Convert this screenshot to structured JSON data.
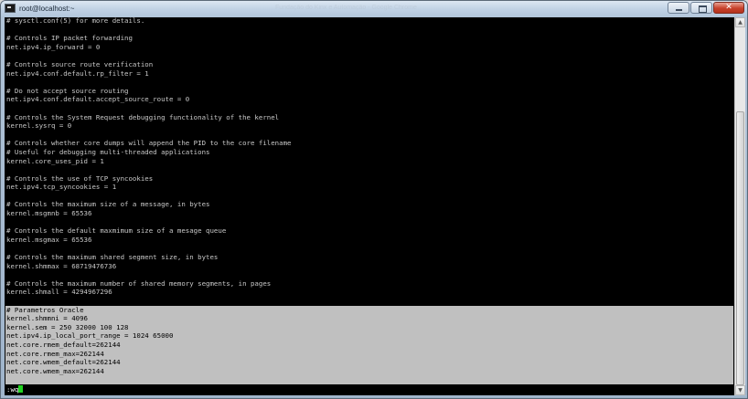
{
  "window": {
    "title": "root@localhost:~",
    "background_caption": "Fundação do Kinx e Automação - Google Chrome",
    "controls": {
      "minimize": "minimize",
      "maximize": "maximize",
      "close": "close"
    }
  },
  "terminal": {
    "lines": [
      "# sysctl.conf(5) for more details.",
      "",
      "# Controls IP packet forwarding",
      "net.ipv4.ip_forward = 0",
      "",
      "# Controls source route verification",
      "net.ipv4.conf.default.rp_filter = 1",
      "",
      "# Do not accept source routing",
      "net.ipv4.conf.default.accept_source_route = 0",
      "",
      "# Controls the System Request debugging functionality of the kernel",
      "kernel.sysrq = 0",
      "",
      "# Controls whether core dumps will append the PID to the core filename",
      "# Useful for debugging multi-threaded applications",
      "kernel.core_uses_pid = 1",
      "",
      "# Controls the use of TCP syncookies",
      "net.ipv4.tcp_syncookies = 1",
      "",
      "# Controls the maximum size of a message, in bytes",
      "kernel.msgmnb = 65536",
      "",
      "# Controls the default maxmimum size of a mesage queue",
      "kernel.msgmax = 65536",
      "",
      "# Controls the maximum shared segment size, in bytes",
      "kernel.shmmax = 68719476736",
      "",
      "# Controls the maximum number of shared memory segments, in pages",
      "kernel.shmall = 4294967296",
      "",
      "# Parametros Oracle",
      "kernel.shmmni = 4096",
      "kernel.sem = 250 32000 100 128",
      "net.ipv4.ip_local_port_range = 1024 65000",
      "net.core.rmem_default=262144",
      "net.core.rmem_max=262144",
      "net.core.wmem_default=262144",
      "net.core.wmem_max=262144",
      ""
    ],
    "selection_start_index": 33,
    "selection_end_index": 41,
    "command_line": ":wq",
    "cursor_color": "#22d422",
    "foreground_color": "#c8c8c8",
    "selection_color": "#c0c0c0"
  },
  "scrollbar": {
    "up_arrow_icon": "scroll-up-arrow-icon",
    "down_arrow_icon": "scroll-down-arrow-icon",
    "position_fraction": 1.0
  }
}
